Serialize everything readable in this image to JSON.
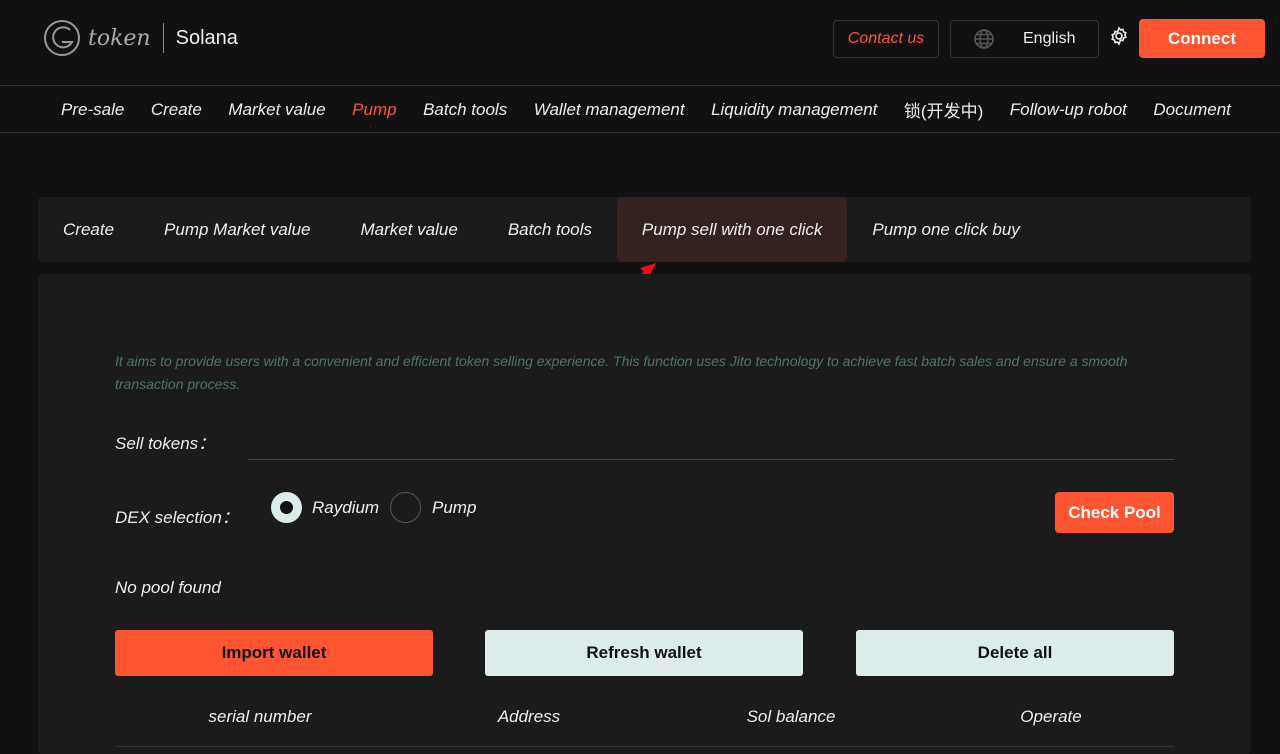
{
  "header": {
    "logo_text": "token",
    "chain": "Solana",
    "contact": "Contact us",
    "language": "English",
    "connect": "Connect"
  },
  "nav": [
    "Pre-sale",
    "Create",
    "Market value",
    "Pump",
    "Batch tools",
    "Wallet management",
    "Liquidity management",
    "锁(开发中)",
    "Follow-up robot",
    "Document"
  ],
  "nav_active": "Pump",
  "subtabs": [
    "Create",
    "Pump Market value",
    "Market value",
    "Batch tools",
    "Pump sell with one click",
    "Pump one click buy"
  ],
  "subtab_active": "Pump sell with one click",
  "panel": {
    "description": "It aims to provide users with a convenient and efficient token selling experience. This function uses Jito technology to achieve fast batch sales and ensure a smooth transaction process.",
    "sell_tokens_label": "Sell tokens：",
    "sell_tokens_value": "",
    "dex_label": "DEX selection：",
    "dex_options": [
      "Raydium",
      "Pump"
    ],
    "dex_selected": "Raydium",
    "check_pool": "Check Pool",
    "pool_status": "No pool found",
    "import_wallet": "Import wallet",
    "refresh_wallet": "Refresh wallet",
    "delete_all": "Delete all",
    "columns": [
      "serial number",
      "Address",
      "Sol balance",
      "Operate"
    ]
  },
  "colors": {
    "accent": "#ff5533",
    "light_button": "#dbeceb"
  }
}
